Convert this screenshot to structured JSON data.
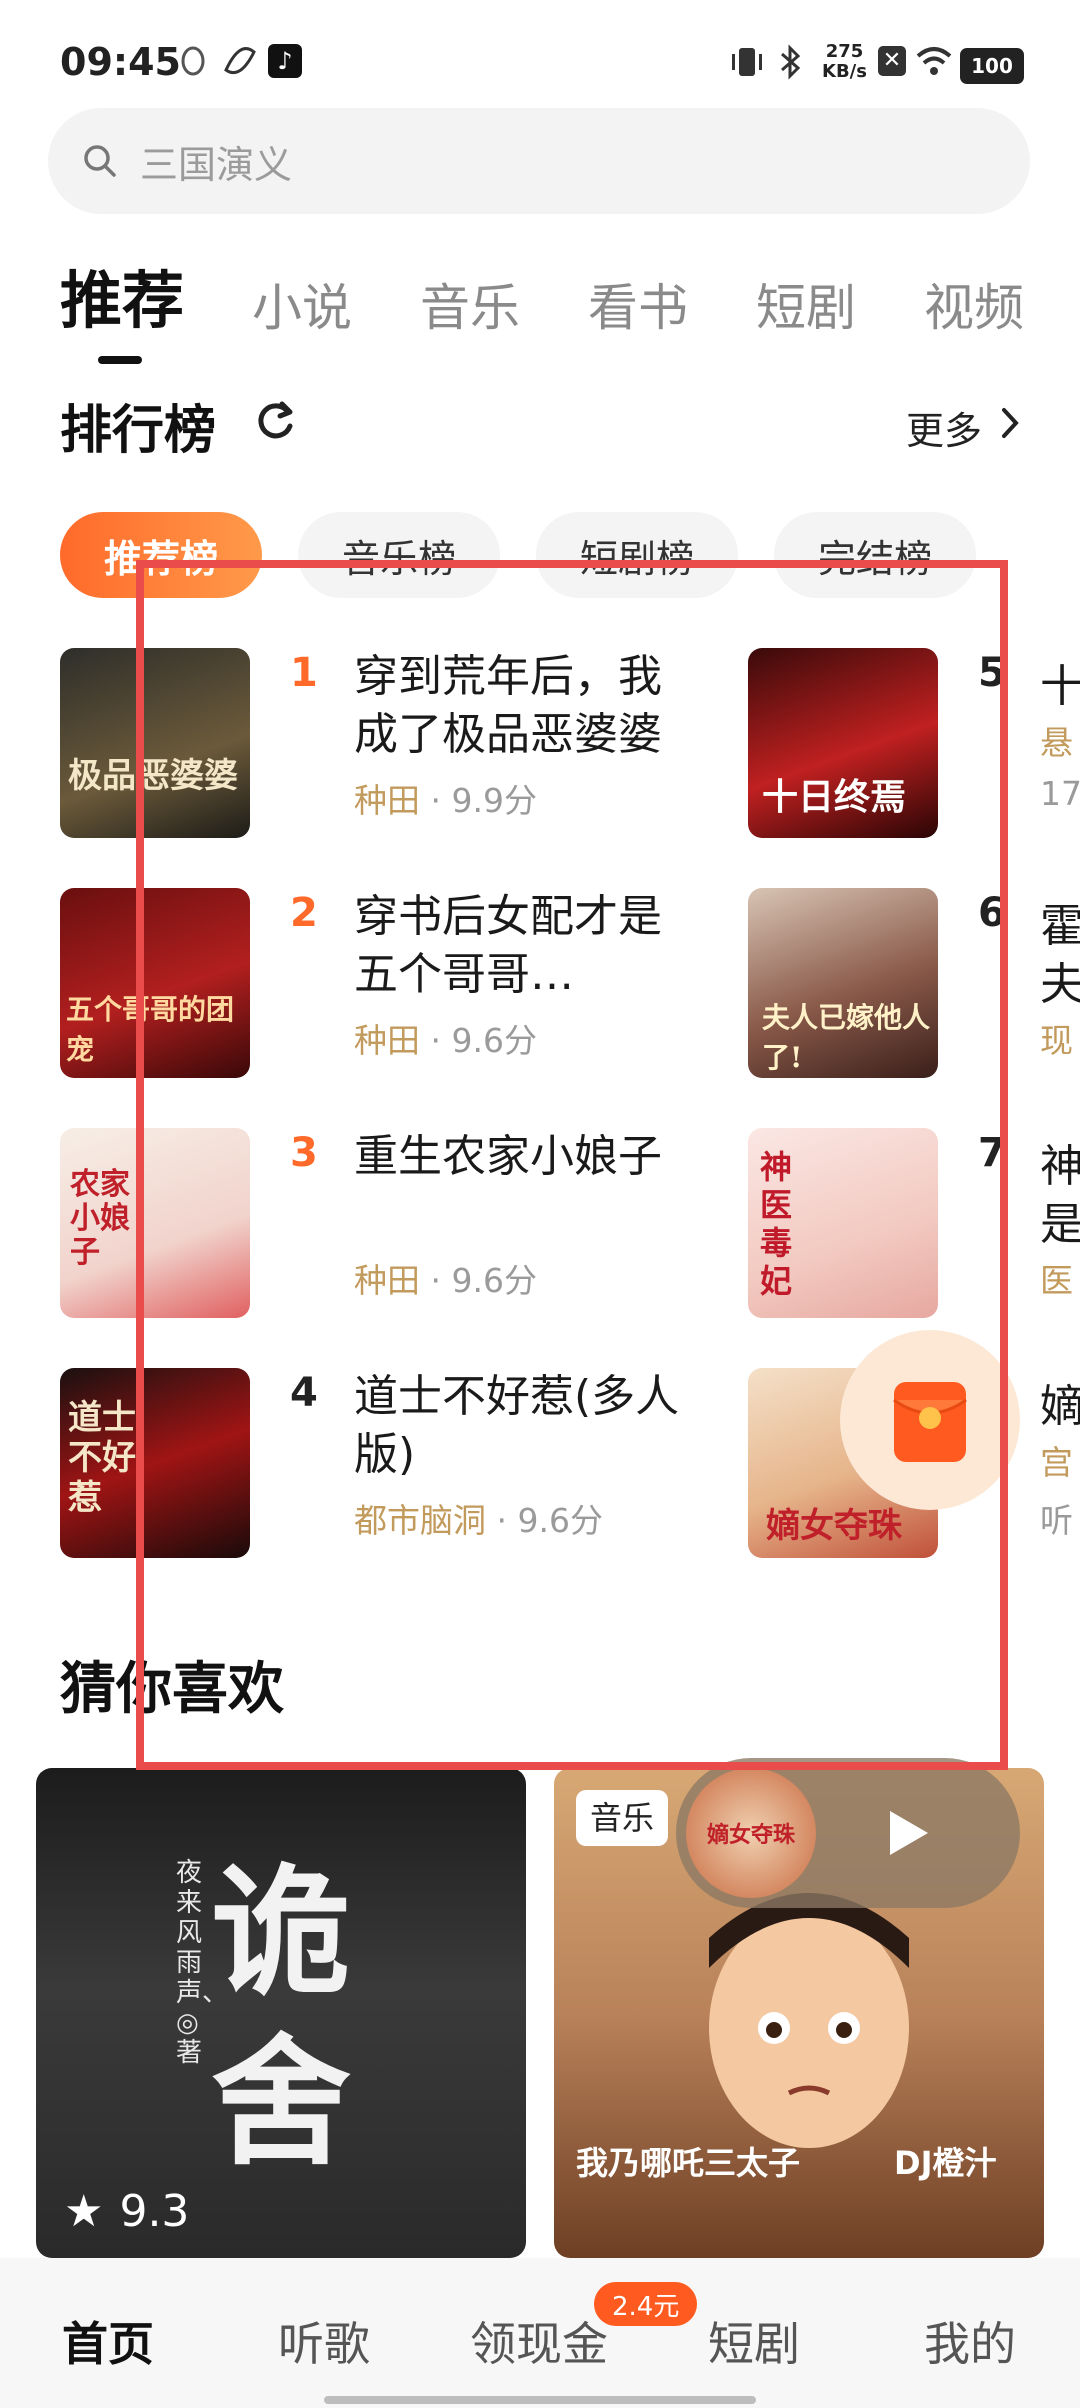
{
  "status_bar": {
    "time": "09:45",
    "net_speed_value": "275",
    "net_speed_unit": "KB/s",
    "battery": "100"
  },
  "search": {
    "placeholder": "三国演义"
  },
  "tabs": [
    "推荐",
    "小说",
    "音乐",
    "看书",
    "短剧",
    "视频"
  ],
  "ranking": {
    "title": "排行榜",
    "more": "更多",
    "chips": [
      "推荐榜",
      "音乐榜",
      "短剧榜",
      "完结榜"
    ],
    "left": [
      {
        "rank": "1",
        "title": "穿到荒年后，我成了极品恶婆婆",
        "genre": "种田",
        "score": "9.9分",
        "cover_text": "极品恶婆婆"
      },
      {
        "rank": "2",
        "title": "穿书后女配才是五个哥哥…",
        "genre": "种田",
        "score": "9.6分",
        "cover_text": "五个哥哥的团宠"
      },
      {
        "rank": "3",
        "title": "重生农家小娘子",
        "genre": "种田",
        "score": "9.6分",
        "cover_text": "农家小娘子"
      },
      {
        "rank": "4",
        "title": "道士不好惹(多人版)",
        "genre": "都市脑洞",
        "score": "9.6分",
        "cover_text": "道士不好惹"
      }
    ],
    "right": [
      {
        "rank": "5",
        "title_fragment": "十",
        "meta_fragment": "悬",
        "meta2_fragment": "17",
        "cover_text": "十日终焉"
      },
      {
        "rank": "6",
        "title_fragment": "霍",
        "title_fragment2": "夫",
        "meta_fragment": "现",
        "cover_text": "夫人已嫁他人了!"
      },
      {
        "rank": "7",
        "title_fragment": "神",
        "title_fragment2": "是",
        "meta_fragment": "医",
        "cover_text": "神医毒妃"
      },
      {
        "rank": "",
        "title_fragment": "嫡",
        "meta_fragment": "宫",
        "meta2_fragment": "听",
        "cover_text": "嫡女夺珠"
      }
    ]
  },
  "guess": {
    "title": "猜你喜欢",
    "cards": [
      {
        "cover_text": "诡舍",
        "author": "夜来风雨声、◎著",
        "rating": "9.3"
      },
      {
        "tag": "音乐",
        "caption": "我乃哪吒三太子",
        "artist": "DJ橙汁"
      }
    ]
  },
  "player": {
    "mini_cover_text": "嫡女夺珠"
  },
  "bottom_nav": [
    "首页",
    "听歌",
    "领现金",
    "短剧",
    "我的"
  ],
  "bottom_badge": "2.4元",
  "colors": {
    "accent": "#ff6a2b",
    "highlight": "#ea4b4b",
    "meta": "#c29a5c"
  }
}
